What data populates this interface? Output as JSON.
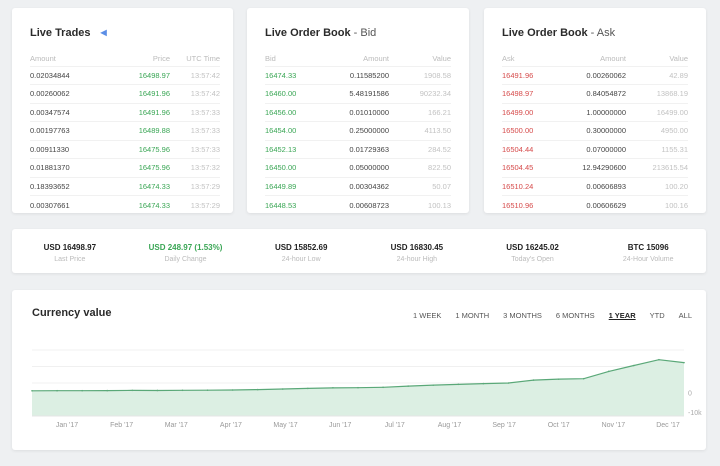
{
  "live_trades": {
    "title": "Live Trades",
    "headers": [
      "Amount",
      "Price",
      "UTC Time"
    ],
    "rows": [
      [
        "0.02034844",
        "16498.97",
        "13:57:42"
      ],
      [
        "0.00260062",
        "16491.96",
        "13:57:42"
      ],
      [
        "0.00347574",
        "16491.96",
        "13:57:33"
      ],
      [
        "0.00197763",
        "16489.88",
        "13:57:33"
      ],
      [
        "0.00911330",
        "16475.96",
        "13:57:33"
      ],
      [
        "0.01881370",
        "16475.96",
        "13:57:32"
      ],
      [
        "0.18393652",
        "16474.33",
        "13:57:29"
      ],
      [
        "0.00307661",
        "16474.33",
        "13:57:29"
      ]
    ]
  },
  "bid_book": {
    "title": "Live Order Book",
    "subtitle": " - Bid",
    "headers": [
      "Bid",
      "Amount",
      "Value"
    ],
    "rows": [
      [
        "16474.33",
        "0.11585200",
        "1908.58"
      ],
      [
        "16460.00",
        "5.48191586",
        "90232.34"
      ],
      [
        "16456.00",
        "0.01010000",
        "166.21"
      ],
      [
        "16454.00",
        "0.25000000",
        "4113.50"
      ],
      [
        "16452.13",
        "0.01729363",
        "284.52"
      ],
      [
        "16450.00",
        "0.05000000",
        "822.50"
      ],
      [
        "16449.89",
        "0.00304362",
        "50.07"
      ],
      [
        "16448.53",
        "0.00608723",
        "100.13"
      ]
    ]
  },
  "ask_book": {
    "title": "Live Order Book",
    "subtitle": " - Ask",
    "headers": [
      "Ask",
      "Amount",
      "Value"
    ],
    "rows": [
      [
        "16491.96",
        "0.00260062",
        "42.89"
      ],
      [
        "16498.97",
        "0.84054872",
        "13868.19"
      ],
      [
        "16499.00",
        "1.00000000",
        "16499.00"
      ],
      [
        "16500.00",
        "0.30000000",
        "4950.00"
      ],
      [
        "16504.44",
        "0.07000000",
        "1155.31"
      ],
      [
        "16504.45",
        "12.94290600",
        "213615.54"
      ],
      [
        "16510.24",
        "0.00606893",
        "100.20"
      ],
      [
        "16510.96",
        "0.00606629",
        "100.16"
      ]
    ]
  },
  "stats": [
    {
      "value": "USD 16498.97",
      "label": "Last Price",
      "color": "#222222"
    },
    {
      "value": "USD 248.97 (1.53%)",
      "label": "Daily Change",
      "color": "#3aa655"
    },
    {
      "value": "USD 15852.69",
      "label": "24-hour Low",
      "color": "#222222"
    },
    {
      "value": "USD 16830.45",
      "label": "24-hour High",
      "color": "#222222"
    },
    {
      "value": "USD 16245.02",
      "label": "Today's Open",
      "color": "#222222"
    },
    {
      "value": "BTC 15096",
      "label": "24-Hour Volume",
      "color": "#222222"
    }
  ],
  "chart_panel": {
    "title": "Currency value",
    "ranges": [
      "1 WEEK",
      "1 MONTH",
      "3 MONTHS",
      "6 MONTHS",
      "1 YEAR",
      "YTD",
      "ALL"
    ],
    "active_range": "1 YEAR"
  },
  "chart_data": {
    "type": "area",
    "title": "Currency value",
    "categories": [
      "Jan '17",
      "Feb '17",
      "Mar '17",
      "Apr '17",
      "May '17",
      "Jun '17",
      "Jul '17",
      "Aug '17",
      "Sep '17",
      "Oct '17",
      "Nov '17",
      "Dec '17"
    ],
    "x": [
      "Jan '17",
      "",
      "Feb '17",
      "",
      "Mar '17",
      "",
      "Apr '17",
      "",
      "May '17",
      "",
      "Jun '17",
      "",
      "Jul '17",
      "",
      "Aug '17",
      "",
      "Sep '17",
      "",
      "Oct '17",
      "",
      "Nov '17",
      "",
      "",
      "Dec '17",
      "",
      "",
      ""
    ],
    "series": [
      {
        "values": [
          1000,
          1020,
          1050,
          1100,
          1200,
          1150,
          1250,
          1300,
          1400,
          1600,
          1900,
          2200,
          2500,
          2600,
          2800,
          3400,
          3900,
          4300,
          4700,
          5000,
          6500,
          7000,
          7200,
          11000,
          14000,
          17000,
          15500
        ]
      }
    ],
    "y_tick_labels": [
      "0",
      "-10k"
    ],
    "ylim": [
      -12000,
      22000
    ],
    "grid": true,
    "colors": {
      "fill": "#dcefe3",
      "line": "#5aa878"
    }
  }
}
